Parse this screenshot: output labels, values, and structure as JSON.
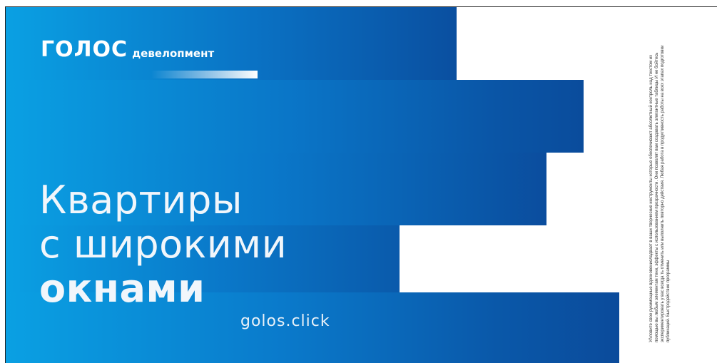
{
  "brand": {
    "name": "ГОЛОС",
    "sub": "девелопмент"
  },
  "headline": {
    "line1": "Квартиры",
    "line2": "с широкими",
    "line3": "окнами"
  },
  "website": "golos.click",
  "legal_text": "УАловите свое рукимощные вдохновениеладвает в ваши творческие инструменты которые обеспечивают абсолютный контроль над текстом их помощью вы любым элементам тени, эффекты с использованием прозрачности. Они позволят вам создавать элегантные таблицы И не бойтесь экспериментировать у вас всегда ть отменить или выполнить повторно действия. Любая работа в продуктивность работы на всех этапах подготовки публикаций. Быстродействие программы",
  "colors": {
    "gradient_start": "#0aa0e3",
    "gradient_end": "#0a4c9c",
    "text": "#ffffff"
  }
}
